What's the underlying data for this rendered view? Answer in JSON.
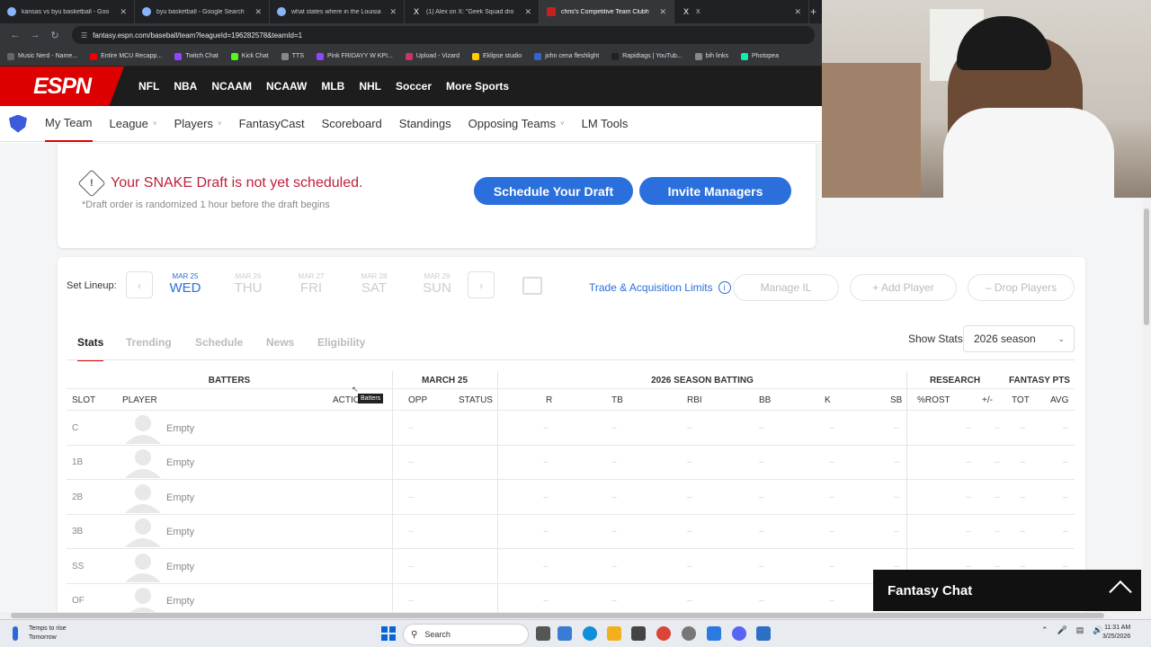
{
  "browser": {
    "tabs": [
      {
        "label": "kansas vs byu basketball - Goo",
        "icon": "google-icon"
      },
      {
        "label": "byu basketball - Google Search",
        "icon": "google-icon"
      },
      {
        "label": "what states where in the Louisia",
        "icon": "globe-icon"
      },
      {
        "label": "(1) Alex on X: \"Geek Squad dro",
        "icon": "x-icon"
      },
      {
        "label": "chris's Competitive Team Clubh",
        "icon": "espn-icon"
      },
      {
        "label": "X",
        "icon": "x-icon"
      }
    ],
    "url": "fantasy.espn.com/baseball/team?leagueId=196282578&teamId=1",
    "bookmarks": [
      {
        "label": "Music Nerd - Name...",
        "color": "#666"
      },
      {
        "label": "Entire MCU Recapp...",
        "color": "#e00"
      },
      {
        "label": "Twitch Chat",
        "color": "#9146ff"
      },
      {
        "label": "Kick Chat",
        "color": "#53fc18"
      },
      {
        "label": "TTS",
        "color": "#888"
      },
      {
        "label": "Pink FRIDAYY W KPI...",
        "color": "#9146ff"
      },
      {
        "label": "Upload - Vizard",
        "color": "#c36"
      },
      {
        "label": "Eklipse studio",
        "color": "#fc0"
      },
      {
        "label": "john cena fleshlight",
        "color": "#36c"
      },
      {
        "label": "Rapidtags | YouTub...",
        "color": "#222"
      },
      {
        "label": "bih links",
        "color": "#888"
      },
      {
        "label": "Photopea",
        "color": "#1ea"
      }
    ]
  },
  "espn": {
    "logo": "ESPN",
    "sports_nav": [
      "NFL",
      "NBA",
      "NCAAM",
      "NCAAW",
      "MLB",
      "NHL",
      "Soccer",
      "More Sports"
    ],
    "fantasy_nav": [
      {
        "label": "My Team",
        "dropdown": false
      },
      {
        "label": "League",
        "dropdown": true
      },
      {
        "label": "Players",
        "dropdown": true
      },
      {
        "label": "FantasyCast",
        "dropdown": false
      },
      {
        "label": "Scoreboard",
        "dropdown": false
      },
      {
        "label": "Standings",
        "dropdown": false
      },
      {
        "label": "Opposing Teams",
        "dropdown": true
      },
      {
        "label": "LM Tools",
        "dropdown": false
      }
    ]
  },
  "draft": {
    "message": "Your SNAKE Draft is not yet scheduled.",
    "note": "*Draft order is randomized 1 hour before the draft begins",
    "schedule_btn": "Schedule Your Draft",
    "invite_btn": "Invite Managers"
  },
  "lineup": {
    "label": "Set Lineup:",
    "days": [
      {
        "date": "MAR 25",
        "dow": "WED",
        "selected": true
      },
      {
        "date": "MAR 26",
        "dow": "THU",
        "selected": false
      },
      {
        "date": "MAR 27",
        "dow": "FRI",
        "selected": false
      },
      {
        "date": "MAR 28",
        "dow": "SAT",
        "selected": false
      },
      {
        "date": "MAR 29",
        "dow": "SUN",
        "selected": false
      }
    ],
    "trade_link": "Trade & Acquisition Limits",
    "manage_il": "Manage IL",
    "add_player": "+ Add Player",
    "drop_players": "– Drop Players"
  },
  "stats_tabs": [
    "Stats",
    "Trending",
    "Schedule",
    "News",
    "Eligibility"
  ],
  "show_stats": {
    "label": "Show Stats",
    "value": "2026 season"
  },
  "table": {
    "group_headers": [
      "BATTERS",
      "MARCH 25",
      "2026 SEASON BATTING",
      "RESEARCH",
      "FANTASY PTS"
    ],
    "col_headers": [
      "SLOT",
      "PLAYER",
      "ACTIO",
      "OPP",
      "STATUS",
      "R",
      "TB",
      "RBI",
      "BB",
      "K",
      "SB",
      "%ROST",
      "+/-",
      "TOT",
      "AVG"
    ],
    "tooltip": "Batters",
    "empty_label": "Empty",
    "dash": "--",
    "slots": [
      "C",
      "1B",
      "2B",
      "3B",
      "SS",
      "OF"
    ]
  },
  "chat": {
    "label": "Fantasy Chat"
  },
  "taskbar": {
    "weather_line1": "Temps to rise",
    "weather_line2": "Tomorrow",
    "search": "Search",
    "time": "11:31 AM",
    "date": "3/25/2026"
  },
  "colors": {
    "espn_red": "#dd0000",
    "link_blue": "#2a6fdb",
    "draft_red": "#c0203a"
  }
}
